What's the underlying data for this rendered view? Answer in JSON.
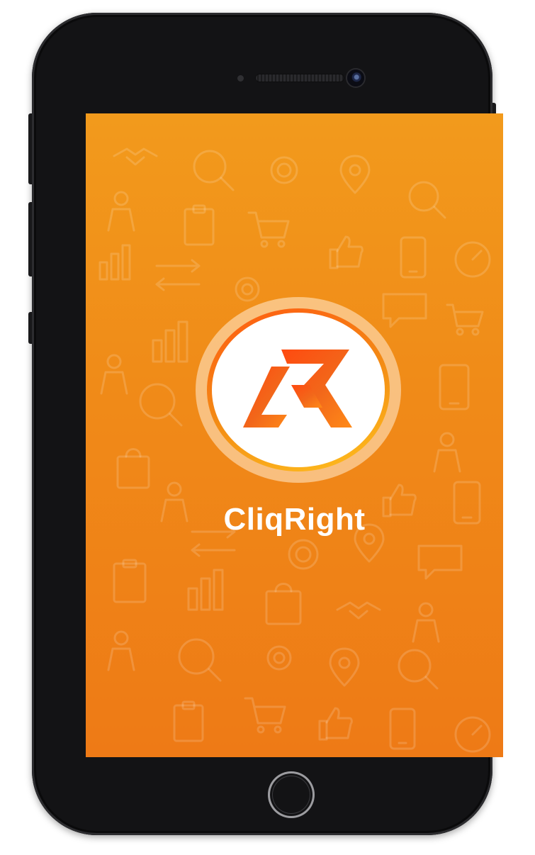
{
  "device": {
    "buttons": {
      "home": "home-button",
      "power": "power-button",
      "volume_up": "volume-up-button",
      "volume_down": "volume-down-button",
      "silent": "silent-switch"
    }
  },
  "splash": {
    "app_name": "CliqRight",
    "logo_icon": "cliqright-cr-logo-icon",
    "background_pattern_icons": [
      "handshake-icon",
      "target-icon",
      "magnifier-icon",
      "bar-chart-icon",
      "thumbs-up-icon",
      "shopping-cart-icon",
      "chat-bubble-icon",
      "location-pin-icon",
      "gauge-icon",
      "arrows-icon",
      "shopping-bag-icon",
      "person-icon"
    ]
  },
  "colors": {
    "brand_orange": "#f0891a",
    "background_top": "#f29a1c",
    "background_bottom": "#ee7a16",
    "logo_gradient_start": "#ff5a12",
    "logo_gradient_end": "#ffc11e",
    "device_body": "#131315"
  }
}
